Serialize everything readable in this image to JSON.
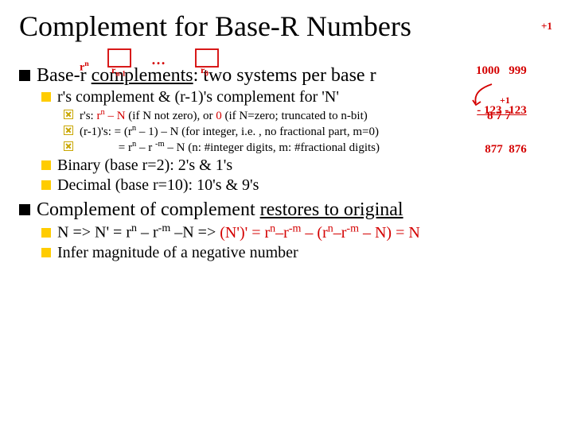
{
  "title": "Complement for Base-R Numbers",
  "lvl1a_pre": "Base-r ",
  "lvl1a_ul": "complements",
  "lvl1a_post": ": two systems per base r",
  "lvl2a": "r's complement & (r-1)'s complement for 'N'",
  "lvl3a_pre": "r's: ",
  "lvl3a_r1": "r",
  "lvl3a_n": "n",
  "lvl3a_mid": " – N",
  "lvl3a_mid2": " (if N not zero), or ",
  "lvl3a_zero": "0",
  "lvl3a_post": " (if N=zero; truncated to n-bit)",
  "lvl3b": "(r-1)'s: = (r",
  "lvl3b_n": "n",
  "lvl3b_post": " – 1) – N (for integer, i.e. , no fractional part, m=0)",
  "lvl3c_pad": "             ",
  "lvl3c": "= r",
  "lvl3c_n": "n",
  "lvl3c_mid": " – r ",
  "lvl3c_m": "-m",
  "lvl3c_post": " – N (n: #integer digits, m: #fractional digits)",
  "lvl2b": "Binary (base r=2): 2's & 1's",
  "lvl2c": "Decimal (base r=10): 10's & 9's",
  "lvl1b_pre": "Complement of complement ",
  "lvl1b_ul": "restores to original",
  "lvl2d_a": "N => N' = r",
  "lvl2d_n1": "n",
  "lvl2d_b": " – r",
  "lvl2d_m1": "-m",
  "lvl2d_c": " –N => ",
  "lvl2d_d": "(N')' = r",
  "lvl2d_n2": "n",
  "lvl2d_e": "–r",
  "lvl2d_m2": "-m",
  "lvl2d_f": " – (r",
  "lvl2d_n3": "n",
  "lvl2d_g": "–r",
  "lvl2d_m3": "-m",
  "lvl2d_h": " – N) = N",
  "lvl2e": "Infer magnitude of a negative number",
  "ann_rn": "r",
  "ann_rn_sup": "n",
  "ann_boxes_left": "r",
  "ann_boxes_left_sub": "n-1",
  "ann_boxes_dots": "…",
  "ann_boxes_right": "r",
  "ann_boxes_right_sub": "0",
  "ann_p1": "+1",
  "ann_col_a": "1000   999",
  "ann_col_b": "- 123 -123",
  "ann_col_c": "  877  876",
  "ann_p1b": "+1",
  "ann_877": "8 7 7"
}
